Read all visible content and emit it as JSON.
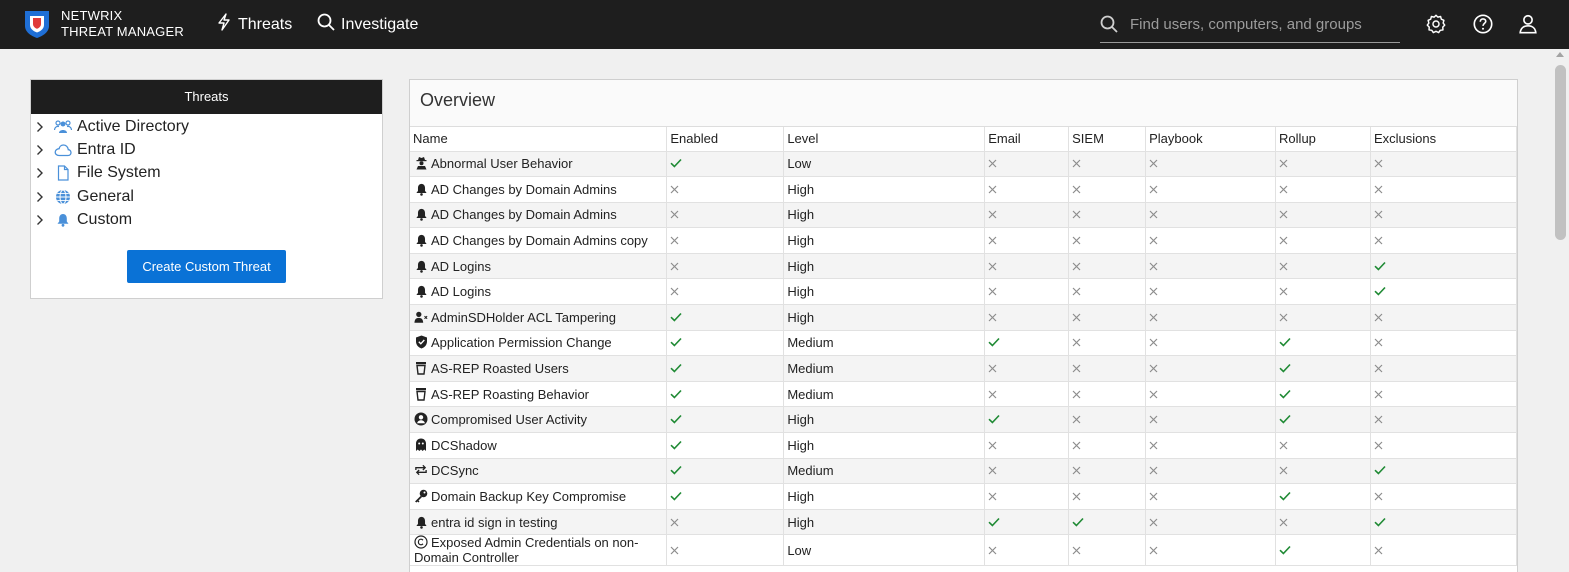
{
  "app": {
    "brand_line1": "NETWRIX",
    "brand_line2": "THREAT MANAGER"
  },
  "nav": {
    "threats": "Threats",
    "investigate": "Investigate"
  },
  "search": {
    "placeholder": "Find users, computers, and groups"
  },
  "left_panel": {
    "title": "Threats",
    "items": [
      {
        "label": "Active Directory",
        "icon": "users-icon"
      },
      {
        "label": "Entra ID",
        "icon": "cloud-icon"
      },
      {
        "label": "File System",
        "icon": "file-icon"
      },
      {
        "label": "General",
        "icon": "globe-icon"
      },
      {
        "label": "Custom",
        "icon": "bell-icon"
      }
    ],
    "create_button": "Create Custom Threat"
  },
  "overview": {
    "title": "Overview",
    "columns": [
      "Name",
      "Enabled",
      "Level",
      "Email",
      "SIEM",
      "Playbook",
      "Rollup",
      "Exclusions"
    ],
    "rows": [
      {
        "name": "Abnormal User Behavior",
        "icon": "user-secret-icon",
        "enabled": true,
        "level": "Low",
        "email": false,
        "siem": false,
        "playbook": false,
        "rollup": false,
        "exclusions": false
      },
      {
        "name": "AD Changes by Domain Admins",
        "icon": "bell-icon",
        "enabled": false,
        "level": "High",
        "email": false,
        "siem": false,
        "playbook": false,
        "rollup": false,
        "exclusions": false
      },
      {
        "name": "AD Changes by Domain Admins",
        "icon": "bell-icon",
        "enabled": false,
        "level": "High",
        "email": false,
        "siem": false,
        "playbook": false,
        "rollup": false,
        "exclusions": false
      },
      {
        "name": "AD Changes by Domain Admins copy",
        "icon": "bell-icon",
        "enabled": false,
        "level": "High",
        "email": false,
        "siem": false,
        "playbook": false,
        "rollup": false,
        "exclusions": false
      },
      {
        "name": "AD Logins",
        "icon": "bell-icon",
        "enabled": false,
        "level": "High",
        "email": false,
        "siem": false,
        "playbook": false,
        "rollup": false,
        "exclusions": true
      },
      {
        "name": "AD Logins",
        "icon": "bell-icon",
        "enabled": false,
        "level": "High",
        "email": false,
        "siem": false,
        "playbook": false,
        "rollup": false,
        "exclusions": true
      },
      {
        "name": "AdminSDHolder ACL Tampering",
        "icon": "user-x-icon",
        "enabled": true,
        "level": "High",
        "email": false,
        "siem": false,
        "playbook": false,
        "rollup": false,
        "exclusions": false
      },
      {
        "name": "Application Permission Change",
        "icon": "shield-check-icon",
        "enabled": true,
        "level": "Medium",
        "email": true,
        "siem": false,
        "playbook": false,
        "rollup": true,
        "exclusions": false
      },
      {
        "name": "AS-REP Roasted Users",
        "icon": "cup-icon",
        "enabled": true,
        "level": "Medium",
        "email": false,
        "siem": false,
        "playbook": false,
        "rollup": true,
        "exclusions": false
      },
      {
        "name": "AS-REP Roasting Behavior",
        "icon": "cup-icon",
        "enabled": true,
        "level": "Medium",
        "email": false,
        "siem": false,
        "playbook": false,
        "rollup": true,
        "exclusions": false
      },
      {
        "name": "Compromised User Activity",
        "icon": "user-circle-icon",
        "enabled": true,
        "level": "High",
        "email": true,
        "siem": false,
        "playbook": false,
        "rollup": true,
        "exclusions": false
      },
      {
        "name": "DCShadow",
        "icon": "ghost-icon",
        "enabled": true,
        "level": "High",
        "email": false,
        "siem": false,
        "playbook": false,
        "rollup": false,
        "exclusions": false
      },
      {
        "name": "DCSync",
        "icon": "sync-icon",
        "enabled": true,
        "level": "Medium",
        "email": false,
        "siem": false,
        "playbook": false,
        "rollup": false,
        "exclusions": true
      },
      {
        "name": "Domain Backup Key Compromise",
        "icon": "key-icon",
        "enabled": true,
        "level": "High",
        "email": false,
        "siem": false,
        "playbook": false,
        "rollup": true,
        "exclusions": false
      },
      {
        "name": "entra id sign in testing",
        "icon": "bell-icon",
        "enabled": false,
        "level": "High",
        "email": true,
        "siem": true,
        "playbook": false,
        "rollup": false,
        "exclusions": true
      },
      {
        "name": "Exposed Admin Credentials on non-Domain Controller",
        "icon": "copyright-icon",
        "enabled": false,
        "level": "Low",
        "email": false,
        "siem": false,
        "playbook": false,
        "rollup": true,
        "exclusions": false
      }
    ]
  },
  "colors": {
    "topbar": "#1e1e1e",
    "accent": "#0a72d6",
    "check": "#1f8a34",
    "cross": "#8d8d8d",
    "tree_icon": "#4a90d9"
  }
}
